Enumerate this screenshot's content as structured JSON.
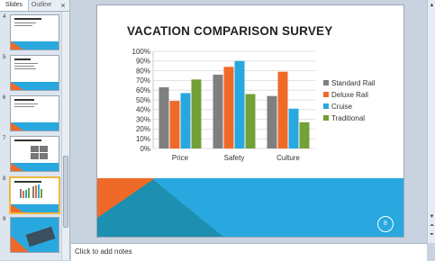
{
  "pane": {
    "tab_slides": "Slides",
    "tab_outline": "Outline",
    "close_glyph": "×",
    "thumbnails": [
      {
        "num": "4",
        "selected": false
      },
      {
        "num": "5",
        "selected": false
      },
      {
        "num": "6",
        "selected": false
      },
      {
        "num": "7",
        "selected": false
      },
      {
        "num": "8",
        "selected": true
      },
      {
        "num": "9",
        "selected": false
      }
    ]
  },
  "slide": {
    "title": "VACATION COMPARISON SURVEY",
    "badge": "8"
  },
  "notes": {
    "placeholder": "Click to add notes"
  },
  "scrollbar": {
    "up": "▲",
    "down": "▼",
    "prev": "⏶",
    "next": "⏷"
  },
  "colors": {
    "blue": "#29a8df",
    "orange": "#ef6a28",
    "teal": "#1d8fb0",
    "series": [
      "#7f7f7f",
      "#ef6a28",
      "#29a8df",
      "#73a037"
    ]
  },
  "chart_data": {
    "type": "bar",
    "categories": [
      "Price",
      "Safety",
      "Culture"
    ],
    "series": [
      {
        "name": "Standard Rail",
        "values": [
          63,
          76,
          54
        ]
      },
      {
        "name": "Deluxe Rail",
        "values": [
          49,
          84,
          79
        ]
      },
      {
        "name": "Cruise",
        "values": [
          57,
          90,
          41
        ]
      },
      {
        "name": "Traditional",
        "values": [
          71,
          56,
          27
        ]
      }
    ],
    "ylim": [
      0,
      100
    ],
    "yticks": [
      "0%",
      "10%",
      "20%",
      "30%",
      "40%",
      "50%",
      "60%",
      "70%",
      "80%",
      "90%",
      "100%"
    ],
    "grid": true,
    "legend": "right"
  }
}
